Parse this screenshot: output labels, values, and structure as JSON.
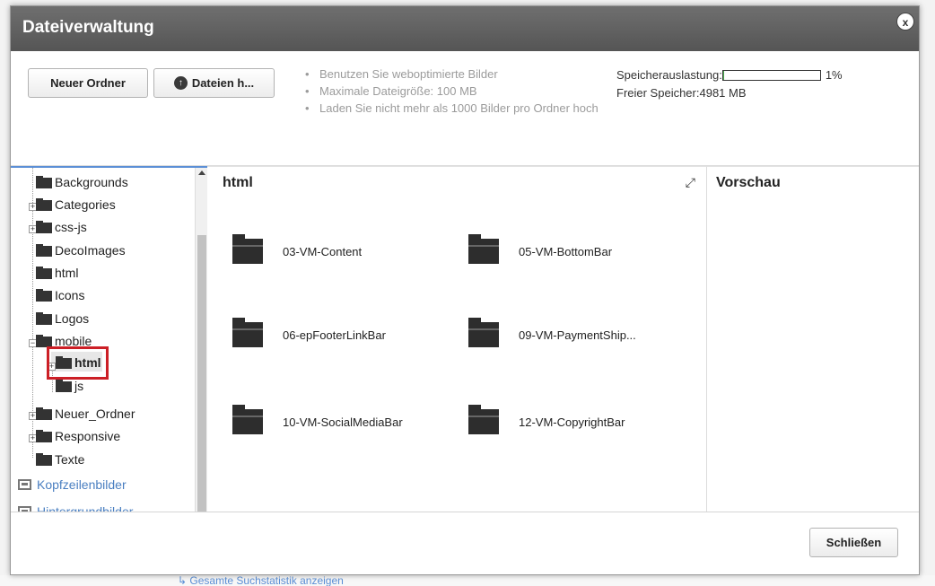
{
  "modal": {
    "title": "Dateiverwaltung",
    "close_label": "x"
  },
  "toolbar": {
    "new_folder_label": "Neuer Ordner",
    "upload_label": "Dateien h...",
    "tips": [
      "Benutzen Sie weboptimierte Bilder",
      "Maximale Dateigröße: 100 MB",
      "Laden Sie nicht mehr als 1000 Bilder pro Ordner hoch"
    ]
  },
  "storage": {
    "usage_label": "Speicherauslastung:",
    "usage_percent": 1,
    "usage_text": "1%",
    "free_label": "Freier Speicher:",
    "free_value": "4981 MB"
  },
  "tree": {
    "items": [
      {
        "label": "Backgrounds"
      },
      {
        "label": "Categories"
      },
      {
        "label": "css-js"
      },
      {
        "label": "DecoImages"
      },
      {
        "label": "html"
      },
      {
        "label": "Icons"
      },
      {
        "label": "Logos"
      },
      {
        "label": "mobile"
      },
      {
        "label": "html"
      },
      {
        "label": "js"
      },
      {
        "label": "Neuer_Ordner"
      },
      {
        "label": "Responsive"
      },
      {
        "label": "Texte"
      }
    ],
    "links": [
      {
        "label": "Kopfzeilenbilder"
      },
      {
        "label": "Hintergrundbilder"
      }
    ]
  },
  "main": {
    "title": "html",
    "folders": [
      {
        "label": "03-VM-Content"
      },
      {
        "label": "05-VM-BottomBar"
      },
      {
        "label": "06-epFooterLinkBar"
      },
      {
        "label": "09-VM-PaymentShip..."
      },
      {
        "label": "10-VM-SocialMediaBar"
      },
      {
        "label": "12-VM-CopyrightBar"
      }
    ]
  },
  "preview": {
    "title": "Vorschau"
  },
  "footer": {
    "close_label": "Schließen"
  },
  "background": {
    "bottom_link": "Gesamte Suchstatistik anzeigen"
  },
  "colors": {
    "header_bg": "#5f5f5f",
    "accent_blue": "#5b8fd6",
    "selection_red": "#cc1f26",
    "storage_fill": "#4caf50"
  }
}
